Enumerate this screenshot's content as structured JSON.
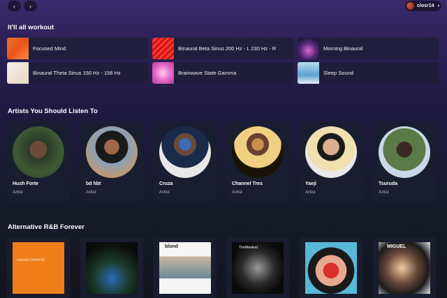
{
  "nav": {
    "back_icon": "‹",
    "forward_icon": "›"
  },
  "user": {
    "name": "closr14",
    "chevron": "▾"
  },
  "sections": {
    "workout": {
      "title": "It'll all workout"
    },
    "artists": {
      "title": "Artists You Should Listen To"
    },
    "rnb": {
      "title": "Alternative R&B Forever"
    }
  },
  "quick_picks": [
    {
      "label": "Focused Mind"
    },
    {
      "label": "Binaural Beta Sinus 200 Hz - L 230 Hz - R"
    },
    {
      "label": "Morning Binaural"
    },
    {
      "label": "Binaural Theta Sinus 150 Hz - 156 Hz"
    },
    {
      "label": "Brainwave State Gamma"
    },
    {
      "label": "Sleep Sound"
    }
  ],
  "artists": [
    {
      "name": "Hush Forte",
      "type": "Artist"
    },
    {
      "name": "bd hbt",
      "type": "Artist"
    },
    {
      "name": "Cruza",
      "type": "Artist"
    },
    {
      "name": "Channel Tres",
      "type": "Artist"
    },
    {
      "name": "Yaeji",
      "type": "Artist"
    },
    {
      "name": "Tsuruda",
      "type": "Artist"
    }
  ],
  "albums": [
    {
      "cover_text": "channel ORANGE"
    },
    {
      "cover_text": ""
    },
    {
      "cover_text": "blond"
    },
    {
      "cover_text": "TheWeeknd"
    },
    {
      "cover_text": ""
    },
    {
      "cover_text": "MIGUEL"
    }
  ]
}
